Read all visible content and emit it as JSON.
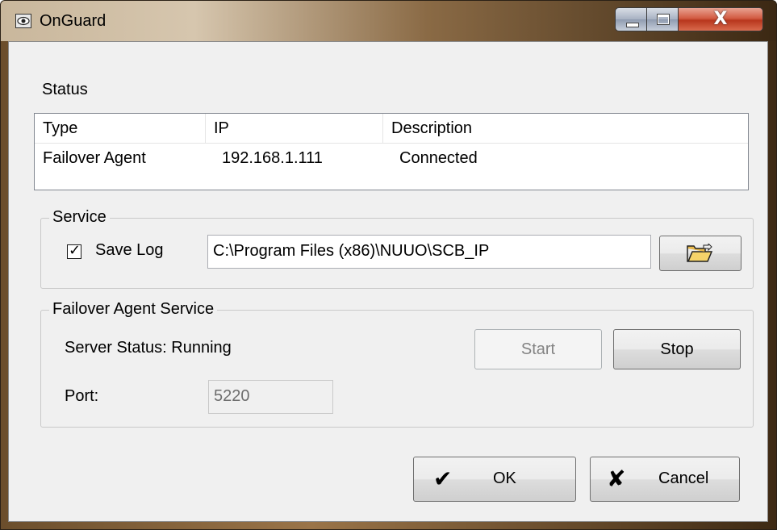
{
  "window": {
    "title": "OnGuard",
    "close_glyph": "X"
  },
  "status": {
    "label": "Status",
    "columns": [
      "Type",
      "IP",
      "Description"
    ],
    "rows": [
      {
        "type": "Failover Agent",
        "ip": "192.168.1.111",
        "description": "Connected"
      }
    ]
  },
  "service": {
    "group_title": "Service",
    "save_log_label": "Save Log",
    "save_log_checked": true,
    "log_path": "C:\\Program Files (x86)\\NUUO\\SCB_IP",
    "browse_icon": "folder-open-icon"
  },
  "failover": {
    "group_title": "Failover Agent Service",
    "server_status": "Server Status: Running",
    "start_label": "Start",
    "stop_label": "Stop",
    "port_label": "Port:",
    "port_value": "5220"
  },
  "footer": {
    "ok_label": "OK",
    "cancel_label": "Cancel"
  },
  "icons": {
    "app": "eye-icon",
    "ok": "checkmark-icon",
    "cancel": "x-icon"
  }
}
